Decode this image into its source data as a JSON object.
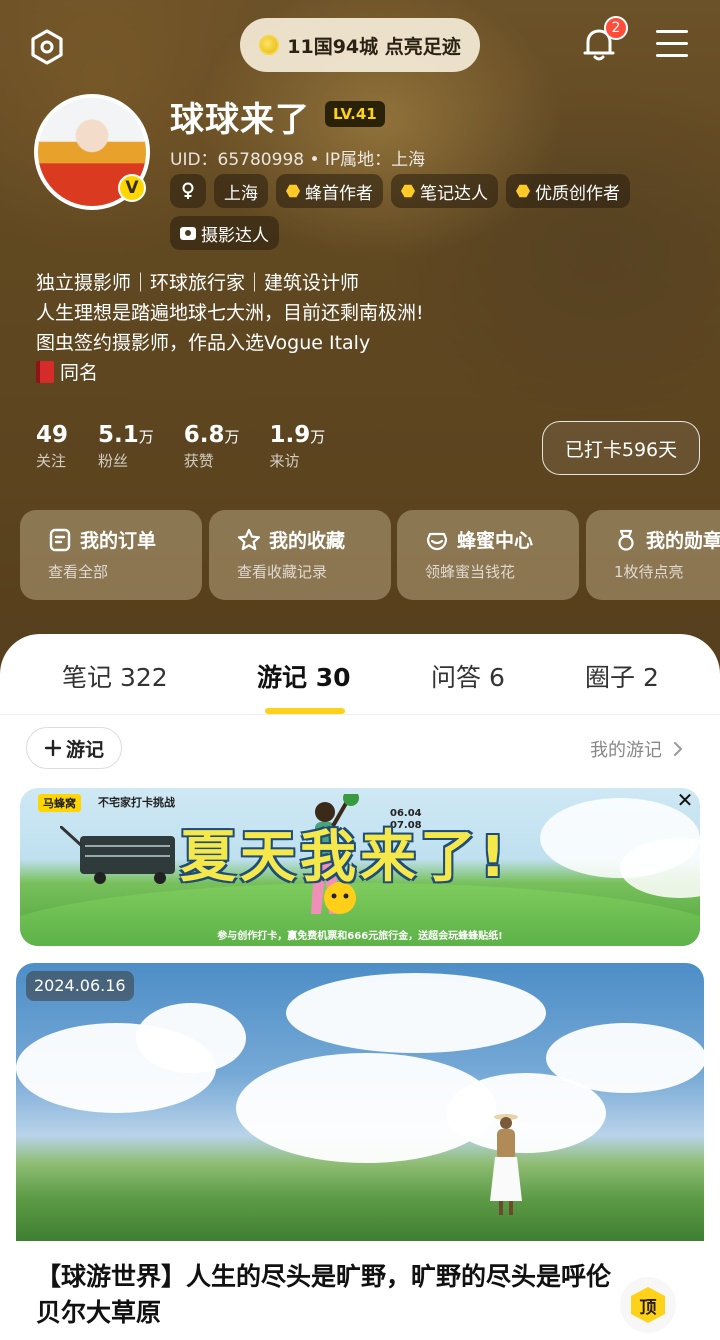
{
  "header": {
    "footprint_text": "11国94城  点亮足迹",
    "notification_count": "2"
  },
  "profile": {
    "name": "球球来了",
    "level": "LV.41",
    "uid_line": "UID：65780998 • IP属地：上海",
    "verified_mark": "V",
    "tags": [
      "上海",
      "蜂首作者",
      "笔记达人",
      "优质创作者",
      "摄影达人"
    ],
    "bio": [
      "独立摄影师｜环球旅行家｜建筑设计师",
      "人生理想是踏遍地球七大洲，目前还剩南极洲!",
      "图虫签约摄影师，作品入选Vogue Italy",
      "同名"
    ]
  },
  "stats": [
    {
      "value": "49",
      "unit": "",
      "label": "关注"
    },
    {
      "value": "5.1",
      "unit": "万",
      "label": "粉丝"
    },
    {
      "value": "6.8",
      "unit": "万",
      "label": "获赞"
    },
    {
      "value": "1.9",
      "unit": "万",
      "label": "来访"
    }
  ],
  "checkin_label": "已打卡596天",
  "quick_actions": [
    {
      "title": "我的订单",
      "sub": "查看全部",
      "icon": "order-icon"
    },
    {
      "title": "我的收藏",
      "sub": "查看收藏记录",
      "icon": "star-icon"
    },
    {
      "title": "蜂蜜中心",
      "sub": "领蜂蜜当钱花",
      "icon": "honey-icon"
    },
    {
      "title": "我的勋章",
      "sub": "1枚待点亮",
      "icon": "medal-icon"
    }
  ],
  "tabs": [
    {
      "label": "笔记 322"
    },
    {
      "label": "游记 30"
    },
    {
      "label": "问答 6"
    },
    {
      "label": "圈子 2"
    }
  ],
  "toolbar": {
    "add_label": "游记",
    "my_trips_label": "我的游记"
  },
  "banner": {
    "brand": "马蜂窝",
    "challenge": "不宅家打卡挑战",
    "dates": [
      "06.04",
      "07.08"
    ],
    "headline": "夏天我来了!",
    "footer": "参与创作打卡，赢免费机票和666元旅行金，送超会玩蜂蜂贴纸!"
  },
  "post": {
    "date": "2024.06.16",
    "title": "【球游世界】人生的尽头是旷野，旷野的尽头是呼伦贝尔大草原",
    "pin_label": "顶"
  }
}
